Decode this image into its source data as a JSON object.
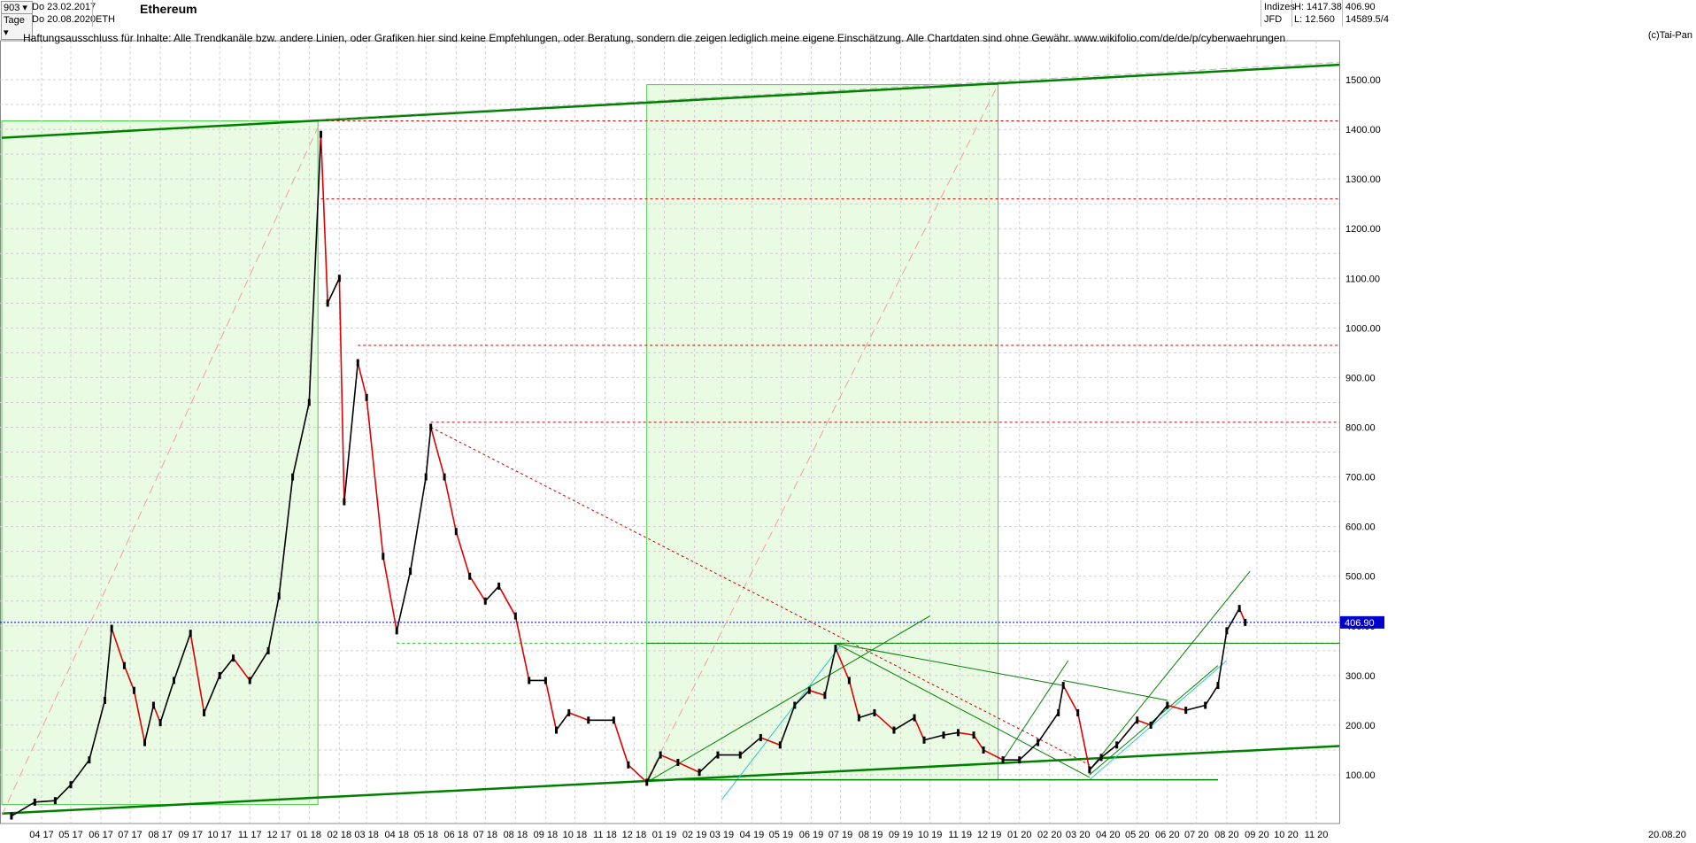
{
  "header": {
    "symbol_select": "903",
    "period_select": "Tage",
    "date_from": "Do 23.02.2017",
    "date_to": "Do 20.08.2020",
    "ticker": "ETH",
    "title": "Ethereum",
    "category": "Indizes",
    "source": "JFD",
    "high_label": "H: 1417.38",
    "low_label": "L: 12.560",
    "last_value": "406.90",
    "last_ratio": "14589.5/4"
  },
  "disclaimer": "Haftungsausschluss für Inhalte: Alle Trendkanäle bzw. andere Linien, oder Grafiken hier sind keine Empfehlungen, oder Beratung, sondern die zeigen lediglich meine eigene Einschätzung. Alle Chartdaten sind ohne Gewähr.  www.wikifolio.com/de/de/p/cyberwaehrungen",
  "copyright": "(c)Tai-Pan",
  "current_price_label": "406.90",
  "last_date_label": "20.08.20",
  "colors": {
    "candle_up": "#000000",
    "candle_down": "#e00000",
    "trend_green": "#008000",
    "box_green": "#e9fbe3",
    "box_border": "#44cc44",
    "resistance": "#cc0000",
    "current_line": "#0000cc",
    "grid": "#cfcfcf"
  },
  "chart_data": {
    "type": "line",
    "title": "Ethereum",
    "ylim": [
      0,
      1600
    ],
    "yticks": [
      "100.00",
      "200.00",
      "300.00",
      "400.00",
      "500.00",
      "600.00",
      "700.00",
      "800.00",
      "900.00",
      "1000.00",
      "1100.00",
      "1200.00",
      "1300.00",
      "1400.00",
      "1500.00"
    ],
    "xticks": [
      "04 17",
      "05 17",
      "06 17",
      "07 17",
      "08 17",
      "09 17",
      "10 17",
      "11 17",
      "12 17",
      "01 18",
      "02 18",
      "03 18",
      "04 18",
      "05 18",
      "06 18",
      "07 18",
      "08 18",
      "09 18",
      "10 18",
      "11 18",
      "12 18",
      "01 19",
      "02 19",
      "03 19",
      "04 19",
      "05 19",
      "06 19",
      "07 19",
      "08 19",
      "09 19",
      "10 19",
      "11 19",
      "12 19",
      "01 20",
      "02 20",
      "03 20",
      "04 20",
      "05 20",
      "06 20",
      "07 20",
      "08 20",
      "09 20",
      "10 20",
      "11 20"
    ],
    "grid": true,
    "series": [
      {
        "values": [
          {
            "x": "2017-03-01",
            "y": 17
          },
          {
            "x": "2017-03-25",
            "y": 45
          },
          {
            "x": "2017-04-15",
            "y": 48
          },
          {
            "x": "2017-05-01",
            "y": 80
          },
          {
            "x": "2017-05-20",
            "y": 130
          },
          {
            "x": "2017-06-05",
            "y": 250
          },
          {
            "x": "2017-06-12",
            "y": 395
          },
          {
            "x": "2017-06-25",
            "y": 320
          },
          {
            "x": "2017-07-05",
            "y": 270
          },
          {
            "x": "2017-07-16",
            "y": 165
          },
          {
            "x": "2017-07-25",
            "y": 240
          },
          {
            "x": "2017-08-01",
            "y": 205
          },
          {
            "x": "2017-08-15",
            "y": 290
          },
          {
            "x": "2017-09-01",
            "y": 385
          },
          {
            "x": "2017-09-15",
            "y": 225
          },
          {
            "x": "2017-10-01",
            "y": 300
          },
          {
            "x": "2017-10-15",
            "y": 335
          },
          {
            "x": "2017-11-01",
            "y": 290
          },
          {
            "x": "2017-11-20",
            "y": 350
          },
          {
            "x": "2017-12-01",
            "y": 460
          },
          {
            "x": "2017-12-15",
            "y": 700
          },
          {
            "x": "2018-01-01",
            "y": 850
          },
          {
            "x": "2018-01-13",
            "y": 1390
          },
          {
            "x": "2018-01-20",
            "y": 1050
          },
          {
            "x": "2018-02-01",
            "y": 1100
          },
          {
            "x": "2018-02-06",
            "y": 650
          },
          {
            "x": "2018-02-20",
            "y": 930
          },
          {
            "x": "2018-03-01",
            "y": 860
          },
          {
            "x": "2018-03-18",
            "y": 540
          },
          {
            "x": "2018-04-01",
            "y": 390
          },
          {
            "x": "2018-04-15",
            "y": 510
          },
          {
            "x": "2018-05-01",
            "y": 700
          },
          {
            "x": "2018-05-06",
            "y": 800
          },
          {
            "x": "2018-05-20",
            "y": 700
          },
          {
            "x": "2018-06-01",
            "y": 590
          },
          {
            "x": "2018-06-15",
            "y": 500
          },
          {
            "x": "2018-07-01",
            "y": 450
          },
          {
            "x": "2018-07-15",
            "y": 480
          },
          {
            "x": "2018-08-01",
            "y": 420
          },
          {
            "x": "2018-08-15",
            "y": 290
          },
          {
            "x": "2018-09-01",
            "y": 290
          },
          {
            "x": "2018-09-12",
            "y": 190
          },
          {
            "x": "2018-09-25",
            "y": 225
          },
          {
            "x": "2018-10-15",
            "y": 210
          },
          {
            "x": "2018-11-10",
            "y": 210
          },
          {
            "x": "2018-11-25",
            "y": 120
          },
          {
            "x": "2018-12-14",
            "y": 85
          },
          {
            "x": "2018-12-28",
            "y": 140
          },
          {
            "x": "2019-01-15",
            "y": 125
          },
          {
            "x": "2019-02-06",
            "y": 105
          },
          {
            "x": "2019-02-25",
            "y": 140
          },
          {
            "x": "2019-03-20",
            "y": 140
          },
          {
            "x": "2019-04-10",
            "y": 175
          },
          {
            "x": "2019-04-30",
            "y": 160
          },
          {
            "x": "2019-05-15",
            "y": 240
          },
          {
            "x": "2019-05-30",
            "y": 270
          },
          {
            "x": "2019-06-15",
            "y": 260
          },
          {
            "x": "2019-06-26",
            "y": 355
          },
          {
            "x": "2019-07-10",
            "y": 290
          },
          {
            "x": "2019-07-20",
            "y": 215
          },
          {
            "x": "2019-08-05",
            "y": 225
          },
          {
            "x": "2019-08-25",
            "y": 190
          },
          {
            "x": "2019-09-15",
            "y": 215
          },
          {
            "x": "2019-09-25",
            "y": 170
          },
          {
            "x": "2019-10-15",
            "y": 180
          },
          {
            "x": "2019-10-30",
            "y": 185
          },
          {
            "x": "2019-11-15",
            "y": 180
          },
          {
            "x": "2019-11-25",
            "y": 150
          },
          {
            "x": "2019-12-15",
            "y": 130
          },
          {
            "x": "2020-01-01",
            "y": 130
          },
          {
            "x": "2020-01-20",
            "y": 165
          },
          {
            "x": "2020-02-10",
            "y": 225
          },
          {
            "x": "2020-02-15",
            "y": 280
          },
          {
            "x": "2020-03-01",
            "y": 225
          },
          {
            "x": "2020-03-13",
            "y": 110
          },
          {
            "x": "2020-03-25",
            "y": 135
          },
          {
            "x": "2020-04-10",
            "y": 160
          },
          {
            "x": "2020-05-01",
            "y": 210
          },
          {
            "x": "2020-05-15",
            "y": 200
          },
          {
            "x": "2020-06-01",
            "y": 240
          },
          {
            "x": "2020-06-20",
            "y": 230
          },
          {
            "x": "2020-07-10",
            "y": 240
          },
          {
            "x": "2020-07-23",
            "y": 280
          },
          {
            "x": "2020-08-01",
            "y": 390
          },
          {
            "x": "2020-08-14",
            "y": 435
          },
          {
            "x": "2020-08-20",
            "y": 407
          }
        ]
      }
    ],
    "horizontal_levels": [
      {
        "y": 1417,
        "style": "resistance"
      },
      {
        "y": 1260,
        "style": "resistance"
      },
      {
        "y": 965,
        "style": "resistance"
      },
      {
        "y": 810,
        "style": "resistance"
      },
      {
        "y": 365,
        "style": "support"
      },
      {
        "y": 407,
        "style": "current"
      }
    ]
  }
}
